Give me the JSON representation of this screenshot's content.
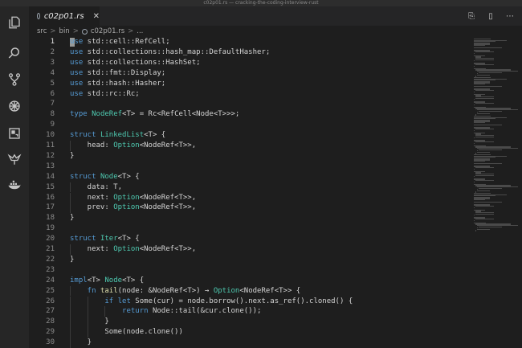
{
  "window": {
    "title": "c02p01.rs — cracking-the-coding-interview-rust"
  },
  "activity_bar": [
    {
      "name": "explorer-icon"
    },
    {
      "name": "search-icon"
    },
    {
      "name": "source-control-icon"
    },
    {
      "name": "debug-icon"
    },
    {
      "name": "extensions-icon"
    },
    {
      "name": "testing-icon"
    },
    {
      "name": "docker-icon"
    }
  ],
  "tab": {
    "label": "c02p01.rs",
    "close": "✕"
  },
  "tab_actions": [
    {
      "name": "split-editor-icon",
      "glyph": "⎘"
    },
    {
      "name": "layout-icon",
      "glyph": "▯"
    },
    {
      "name": "more-actions-icon",
      "glyph": "⋯"
    }
  ],
  "breadcrumb": {
    "items": [
      "src",
      "bin",
      "c02p01.rs",
      "..."
    ],
    "separator": ">"
  },
  "editor": {
    "current_line": 1,
    "lines": [
      {
        "n": "1",
        "indent": 0,
        "tokens": [
          {
            "t": "use",
            "c": "kw"
          },
          {
            "t": " std::cell::RefCell;"
          }
        ]
      },
      {
        "n": "2",
        "indent": 0,
        "tokens": [
          {
            "t": "use",
            "c": "kw"
          },
          {
            "t": " std::collections::hash_map::DefaultHasher;"
          }
        ]
      },
      {
        "n": "3",
        "indent": 0,
        "tokens": [
          {
            "t": "use",
            "c": "kw"
          },
          {
            "t": " std::collections::HashSet;"
          }
        ]
      },
      {
        "n": "4",
        "indent": 0,
        "tokens": [
          {
            "t": "use",
            "c": "kw"
          },
          {
            "t": " std::fmt::Display;"
          }
        ]
      },
      {
        "n": "5",
        "indent": 0,
        "tokens": [
          {
            "t": "use",
            "c": "kw"
          },
          {
            "t": " std::hash::Hasher;"
          }
        ]
      },
      {
        "n": "6",
        "indent": 0,
        "tokens": [
          {
            "t": "use",
            "c": "kw"
          },
          {
            "t": " std::rc::Rc;"
          }
        ]
      },
      {
        "n": "7",
        "indent": 0,
        "tokens": []
      },
      {
        "n": "8",
        "indent": 0,
        "tokens": [
          {
            "t": "type",
            "c": "kw"
          },
          {
            "t": " "
          },
          {
            "t": "NodeRef",
            "c": "ty"
          },
          {
            "t": "<T> = Rc<RefCell<Node<T>>>;"
          }
        ]
      },
      {
        "n": "9",
        "indent": 0,
        "tokens": []
      },
      {
        "n": "10",
        "indent": 0,
        "tokens": [
          {
            "t": "struct",
            "c": "kw"
          },
          {
            "t": " "
          },
          {
            "t": "LinkedList",
            "c": "ty"
          },
          {
            "t": "<T> {"
          }
        ]
      },
      {
        "n": "11",
        "indent": 1,
        "tokens": [
          {
            "t": "head: "
          },
          {
            "t": "Option",
            "c": "ty"
          },
          {
            "t": "<NodeRef<T>>,"
          }
        ]
      },
      {
        "n": "12",
        "indent": 0,
        "tokens": [
          {
            "t": "}"
          }
        ]
      },
      {
        "n": "13",
        "indent": 0,
        "tokens": []
      },
      {
        "n": "14",
        "indent": 0,
        "tokens": [
          {
            "t": "struct",
            "c": "kw"
          },
          {
            "t": " "
          },
          {
            "t": "Node",
            "c": "ty"
          },
          {
            "t": "<T> {"
          }
        ]
      },
      {
        "n": "15",
        "indent": 1,
        "tokens": [
          {
            "t": "data: T,"
          }
        ]
      },
      {
        "n": "16",
        "indent": 1,
        "tokens": [
          {
            "t": "next: "
          },
          {
            "t": "Option",
            "c": "ty"
          },
          {
            "t": "<NodeRef<T>>,"
          }
        ]
      },
      {
        "n": "17",
        "indent": 1,
        "tokens": [
          {
            "t": "prev: "
          },
          {
            "t": "Option",
            "c": "ty"
          },
          {
            "t": "<NodeRef<T>>,"
          }
        ]
      },
      {
        "n": "18",
        "indent": 0,
        "tokens": [
          {
            "t": "}"
          }
        ]
      },
      {
        "n": "19",
        "indent": 0,
        "tokens": []
      },
      {
        "n": "20",
        "indent": 0,
        "tokens": [
          {
            "t": "struct",
            "c": "kw"
          },
          {
            "t": " "
          },
          {
            "t": "Iter",
            "c": "ty"
          },
          {
            "t": "<T> {"
          }
        ]
      },
      {
        "n": "21",
        "indent": 1,
        "tokens": [
          {
            "t": "next: "
          },
          {
            "t": "Option",
            "c": "ty"
          },
          {
            "t": "<NodeRef<T>>,"
          }
        ]
      },
      {
        "n": "22",
        "indent": 0,
        "tokens": [
          {
            "t": "}"
          }
        ]
      },
      {
        "n": "23",
        "indent": 0,
        "tokens": []
      },
      {
        "n": "24",
        "indent": 0,
        "tokens": [
          {
            "t": "impl",
            "c": "kw"
          },
          {
            "t": "<T> "
          },
          {
            "t": "Node",
            "c": "ty"
          },
          {
            "t": "<T> {"
          }
        ]
      },
      {
        "n": "25",
        "indent": 1,
        "tokens": [
          {
            "t": "fn",
            "c": "kw"
          },
          {
            "t": " "
          },
          {
            "t": "tail",
            "c": "fn"
          },
          {
            "t": "(node: &NodeRef<T>) → "
          },
          {
            "t": "Option",
            "c": "ty"
          },
          {
            "t": "<NodeRef<T>> {"
          }
        ]
      },
      {
        "n": "26",
        "indent": 2,
        "tokens": [
          {
            "t": "if",
            "c": "kw"
          },
          {
            "t": " "
          },
          {
            "t": "let",
            "c": "kw"
          },
          {
            "t": " Some(cur) = node.borrow().next.as_ref().cloned() {"
          }
        ]
      },
      {
        "n": "27",
        "indent": 3,
        "tokens": [
          {
            "t": "return",
            "c": "kw"
          },
          {
            "t": " Node::tail(&cur.clone());"
          }
        ]
      },
      {
        "n": "28",
        "indent": 2,
        "tokens": [
          {
            "t": "}"
          }
        ]
      },
      {
        "n": "29",
        "indent": 2,
        "tokens": [
          {
            "t": "Some(node.clone())"
          }
        ]
      },
      {
        "n": "30",
        "indent": 1,
        "tokens": [
          {
            "t": "}"
          }
        ]
      }
    ]
  },
  "colors": {
    "keyword": "#569cd6",
    "type": "#4ec9b0",
    "function": "#dcdcaa",
    "text": "#d4d4d4",
    "background": "#1e1e1e"
  }
}
